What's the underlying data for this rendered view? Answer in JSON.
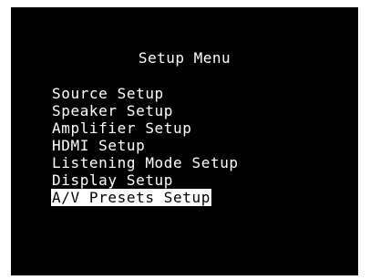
{
  "menu": {
    "title": "Setup Menu",
    "items": [
      {
        "label": "Source Setup",
        "selected": false
      },
      {
        "label": "Speaker Setup",
        "selected": false
      },
      {
        "label": "Amplifier Setup",
        "selected": false
      },
      {
        "label": "HDMI Setup",
        "selected": false
      },
      {
        "label": "Listening Mode Setup",
        "selected": false
      },
      {
        "label": "Display Setup",
        "selected": false
      },
      {
        "label": "A/V Presets Setup",
        "selected": true
      }
    ]
  },
  "colors": {
    "background": "#000000",
    "text": "#ffffff",
    "highlight_background": "#ffffff",
    "highlight_text": "#000000"
  }
}
